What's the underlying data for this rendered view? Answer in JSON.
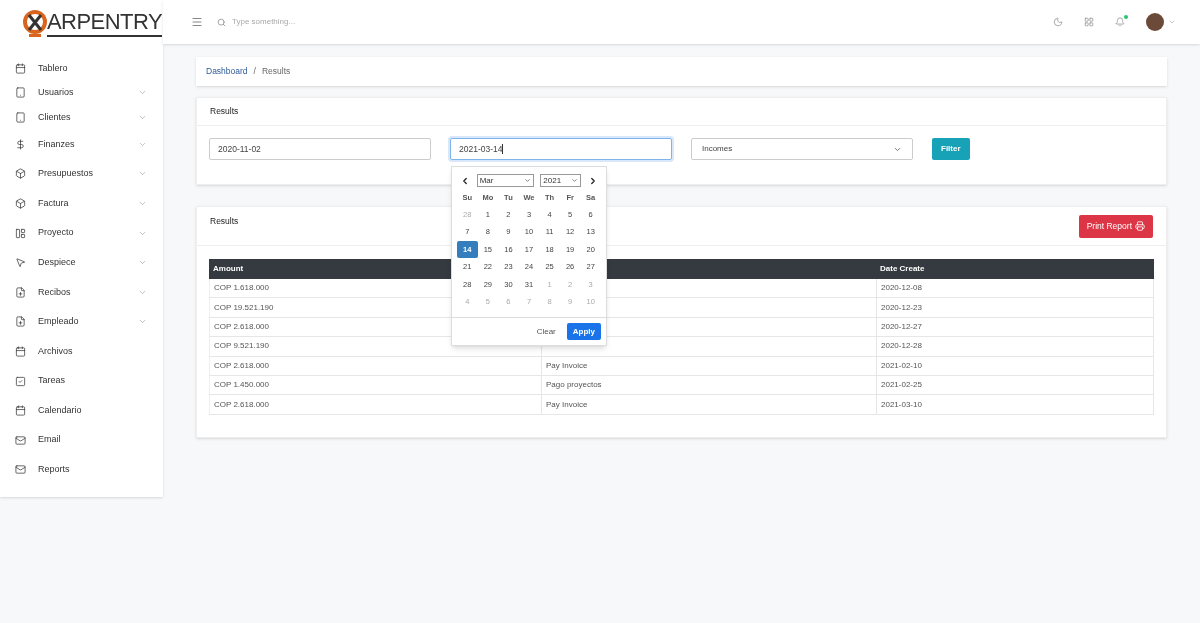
{
  "logo": {
    "text": "ARPENTRY"
  },
  "sidebar": {
    "items": [
      {
        "label": "Tablero",
        "expandable": false
      },
      {
        "label": "Usuarios",
        "expandable": true
      },
      {
        "label": "Clientes",
        "expandable": true
      },
      {
        "label": "Finanzes",
        "expandable": true
      },
      {
        "label": "Presupuestos",
        "expandable": true
      },
      {
        "label": "Factura",
        "expandable": true
      },
      {
        "label": "Proyecto",
        "expandable": true
      },
      {
        "label": "Despiece",
        "expandable": true
      },
      {
        "label": "Recibos",
        "expandable": true
      },
      {
        "label": "Empleado",
        "expandable": true
      },
      {
        "label": "Archivos",
        "expandable": false
      },
      {
        "label": "Tareas",
        "expandable": false
      },
      {
        "label": "Calendario",
        "expandable": false
      },
      {
        "label": "Email",
        "expandable": false
      },
      {
        "label": "Reports",
        "expandable": false
      }
    ]
  },
  "topbar": {
    "search": {
      "placeholder": "Type something..."
    },
    "notifications": {
      "unread": true
    }
  },
  "breadcrumb": {
    "separator": "/",
    "items": [
      {
        "label": "Dashboard",
        "link": true
      },
      {
        "label": "Results",
        "link": false
      }
    ]
  },
  "filter_card": {
    "title": "Results",
    "start_date": "2020-11-02",
    "end_date": "2021-03-14",
    "type": "Incomes",
    "button": "Filter"
  },
  "datepicker": {
    "month": "Mar",
    "year": "2021",
    "weekdays": [
      "Su",
      "Mo",
      "Tu",
      "We",
      "Th",
      "Fr",
      "Sa"
    ],
    "weeks": [
      [
        {
          "d": "28",
          "outside": true,
          "selected": false
        },
        {
          "d": "1",
          "outside": false,
          "selected": false
        },
        {
          "d": "2",
          "outside": false,
          "selected": false
        },
        {
          "d": "3",
          "outside": false,
          "selected": false
        },
        {
          "d": "4",
          "outside": false,
          "selected": false
        },
        {
          "d": "5",
          "outside": false,
          "selected": false
        },
        {
          "d": "6",
          "outside": false,
          "selected": false
        }
      ],
      [
        {
          "d": "7",
          "outside": false,
          "selected": false
        },
        {
          "d": "8",
          "outside": false,
          "selected": false
        },
        {
          "d": "9",
          "outside": false,
          "selected": false
        },
        {
          "d": "10",
          "outside": false,
          "selected": false
        },
        {
          "d": "11",
          "outside": false,
          "selected": false
        },
        {
          "d": "12",
          "outside": false,
          "selected": false
        },
        {
          "d": "13",
          "outside": false,
          "selected": false
        }
      ],
      [
        {
          "d": "14",
          "outside": false,
          "selected": true
        },
        {
          "d": "15",
          "outside": false,
          "selected": false
        },
        {
          "d": "16",
          "outside": false,
          "selected": false
        },
        {
          "d": "17",
          "outside": false,
          "selected": false
        },
        {
          "d": "18",
          "outside": false,
          "selected": false
        },
        {
          "d": "19",
          "outside": false,
          "selected": false
        },
        {
          "d": "20",
          "outside": false,
          "selected": false
        }
      ],
      [
        {
          "d": "21",
          "outside": false,
          "selected": false
        },
        {
          "d": "22",
          "outside": false,
          "selected": false
        },
        {
          "d": "23",
          "outside": false,
          "selected": false
        },
        {
          "d": "24",
          "outside": false,
          "selected": false
        },
        {
          "d": "25",
          "outside": false,
          "selected": false
        },
        {
          "d": "26",
          "outside": false,
          "selected": false
        },
        {
          "d": "27",
          "outside": false,
          "selected": false
        }
      ],
      [
        {
          "d": "28",
          "outside": false,
          "selected": false
        },
        {
          "d": "29",
          "outside": false,
          "selected": false
        },
        {
          "d": "30",
          "outside": false,
          "selected": false
        },
        {
          "d": "31",
          "outside": false,
          "selected": false
        },
        {
          "d": "1",
          "outside": true,
          "selected": false
        },
        {
          "d": "2",
          "outside": true,
          "selected": false
        },
        {
          "d": "3",
          "outside": true,
          "selected": false
        }
      ],
      [
        {
          "d": "4",
          "outside": true,
          "selected": false
        },
        {
          "d": "5",
          "outside": true,
          "selected": false
        },
        {
          "d": "6",
          "outside": true,
          "selected": false
        },
        {
          "d": "7",
          "outside": true,
          "selected": false
        },
        {
          "d": "8",
          "outside": true,
          "selected": false
        },
        {
          "d": "9",
          "outside": true,
          "selected": false
        },
        {
          "d": "10",
          "outside": true,
          "selected": false
        }
      ]
    ],
    "buttons": [
      "Clear",
      "Apply"
    ]
  },
  "results_card": {
    "title": "Results",
    "print_button": "Print Report",
    "table": {
      "columns": [
        "Amount",
        "Date Create"
      ],
      "rows": [
        {
          "amount": "COP 1.618.000",
          "date": "2020-12-08"
        },
        {
          "amount": "COP 19.521.190",
          "date": "2020-12-23"
        },
        {
          "amount": "COP 2.618.000",
          "date": "2020-12-27"
        },
        {
          "amount": "COP 9.521.190",
          "date": "2020-12-28"
        },
        {
          "amount": "COP 2.618.000",
          "concept": "Pay Invoice",
          "date": "2021-02-10"
        },
        {
          "amount": "COP 1.450.000",
          "concept": "Pago proyectos",
          "date": "2021-02-25"
        },
        {
          "amount": "COP 2.618.000",
          "concept": "Pay Invoice",
          "date": "2021-03-10"
        }
      ]
    }
  }
}
